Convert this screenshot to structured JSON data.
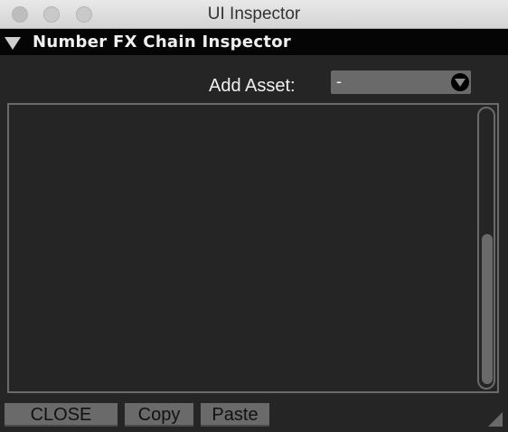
{
  "window": {
    "title": "UI Inspector"
  },
  "section": {
    "title": "Number FX Chain Inspector",
    "expanded": true
  },
  "add_asset": {
    "label": "Add Asset:",
    "selected": "-"
  },
  "list": {
    "items": []
  },
  "buttons": {
    "close_label": "CLOSE",
    "copy_label": "Copy",
    "paste_label": "Paste"
  },
  "colors": {
    "background": "#252525",
    "header_bg": "#050505",
    "control_gray": "#6a6a6a"
  },
  "icons": {
    "disclosure": "triangle-down-icon",
    "dropdown": "chevron-down-circle-icon",
    "resize": "resize-grip-icon"
  }
}
